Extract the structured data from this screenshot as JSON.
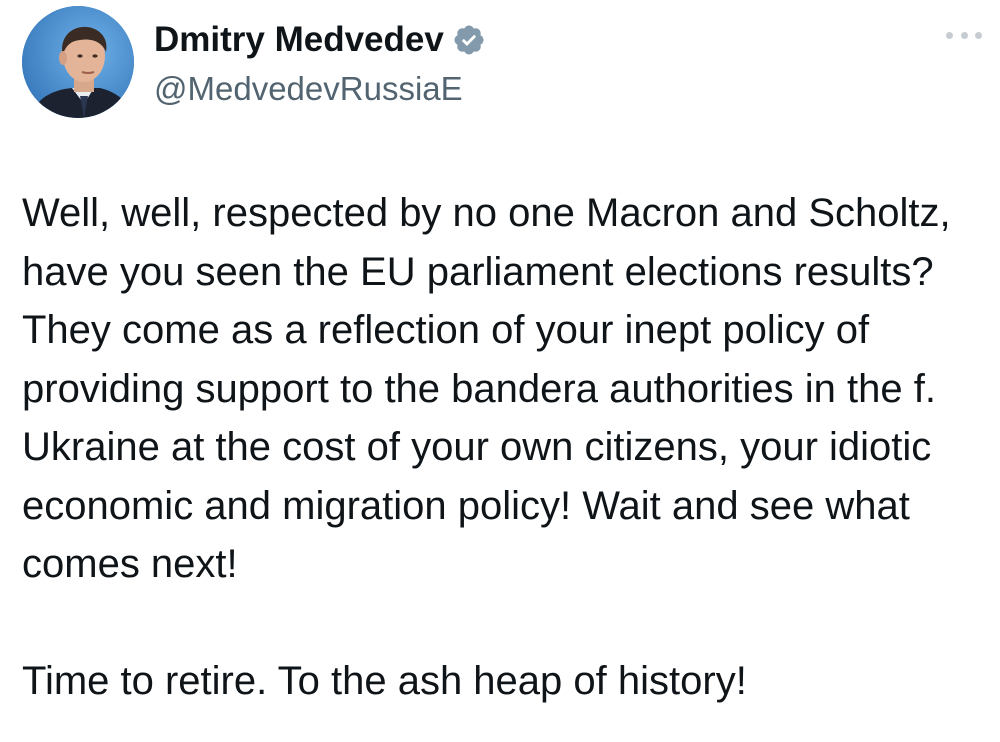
{
  "author": {
    "display_name": "Dmitry Medvedev",
    "handle": "@MedvedevRussiaE",
    "verified": true,
    "avatar": "profile-photo"
  },
  "menu_icon": "more-dots-icon",
  "tweet": {
    "paragraph_1": "Well, well, respected by no one Macron and Scholtz, have you seen the EU parliament elections results? They come as a reflection of your inept policy of providing support to the bandera authorities in the f. Ukraine at the cost of your own citizens, your idiotic economic and migration policy! Wait and see what comes next!",
    "paragraph_2": "Time to retire. To the ash heap of history!"
  },
  "colors": {
    "text": "#0f1419",
    "secondary_text": "#536471",
    "verified_badge": "#829aab",
    "more_dots": "#c6ccd1",
    "avatar_bg": "#3d7fc2"
  }
}
